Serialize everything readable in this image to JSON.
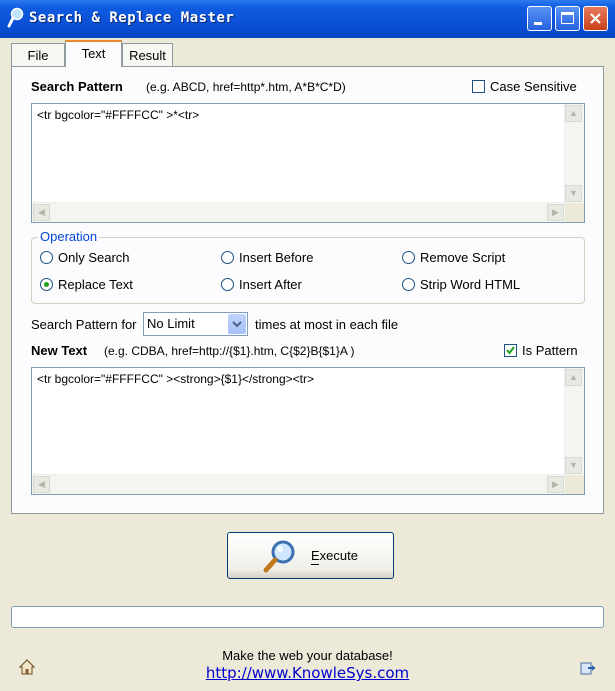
{
  "window": {
    "title": "Search & Replace Master"
  },
  "tabs": [
    {
      "label": "File"
    },
    {
      "label": "Text"
    },
    {
      "label": "Result"
    }
  ],
  "active_tab": "Text",
  "search": {
    "label": "Search Pattern",
    "example": "(e.g.  ABCD, href=http*.htm, A*B*C*D)",
    "case_sensitive_label": "Case Sensitive",
    "case_sensitive_checked": false,
    "value": "<tr bgcolor=\"#FFFFCC\" >*<tr>"
  },
  "operation": {
    "legend": "Operation",
    "options": [
      {
        "label": "Only Search",
        "selected": false
      },
      {
        "label": "Insert Before",
        "selected": false
      },
      {
        "label": "Remove Script",
        "selected": false
      },
      {
        "label": "Replace Text",
        "selected": true
      },
      {
        "label": "Insert After",
        "selected": false
      },
      {
        "label": "Strip Word HTML",
        "selected": false
      }
    ]
  },
  "limit": {
    "prefix": "Search Pattern for",
    "selected": "No Limit",
    "suffix": "times at most in each file"
  },
  "new_text": {
    "label": "New Text",
    "example": "(e.g.   CDBA,  href=http://{$1}.htm,  C{$2}B{$1}A  )",
    "is_pattern_label": "Is Pattern",
    "is_pattern_checked": true,
    "value": "<tr bgcolor=\"#FFFFCC\" ><strong>{$1}</strong><tr>"
  },
  "execute": {
    "label": "Execute",
    "icon": "magnifier-icon"
  },
  "footer": {
    "tagline": "Make the web your database!",
    "link": "http://www.KnowleSys.com"
  },
  "colors": {
    "titlebar": "#0A4FD4",
    "tab_highlight": "#E68B2C",
    "groupbox_legend": "#0046D5",
    "radio_dot": "#21A121",
    "check_mark": "#21A121",
    "link": "#0000D0"
  }
}
